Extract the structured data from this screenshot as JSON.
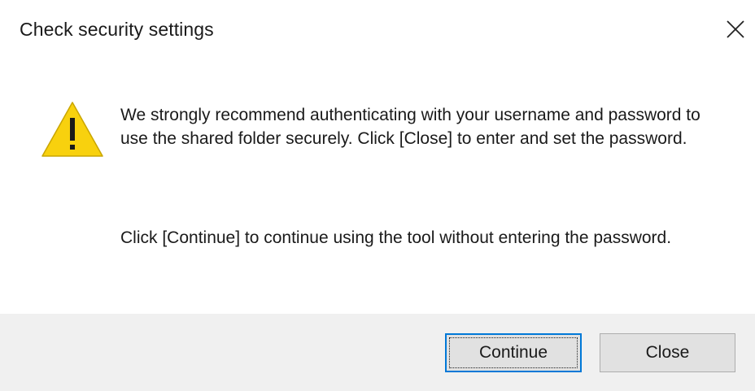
{
  "dialog": {
    "title": "Check security settings",
    "close_icon": "close-icon",
    "warning_icon": "warning-icon",
    "message_1": "We strongly recommend authenticating with your username and password to use the shared folder securely. Click [Close] to enter and set the password.",
    "message_2": "Click [Continue] to continue using the tool without entering the password.",
    "buttons": {
      "continue_label": "Continue",
      "close_label": "Close"
    },
    "colors": {
      "warning_fill": "#f8d10e",
      "focus_border": "#0078d7",
      "footer_bg": "#f0f0f0"
    }
  }
}
